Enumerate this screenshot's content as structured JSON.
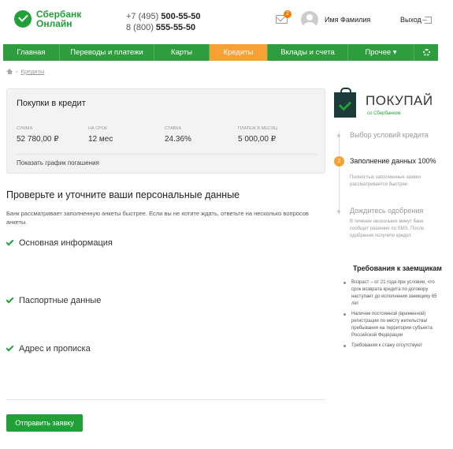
{
  "header": {
    "logo_line1": "Сбербанк",
    "logo_line2": "Онлайн",
    "phone1_prefix": "+7 (495) ",
    "phone1_number": "500-55-50",
    "phone2_prefix": "8 (800) ",
    "phone2_number": "555-55-50",
    "mail_count": "2",
    "user_name": "Имя Фамилия",
    "logout_label": "Выход"
  },
  "nav": {
    "items": [
      {
        "label": "Главная"
      },
      {
        "label": "Переводы и платежи"
      },
      {
        "label": "Карты"
      },
      {
        "label": "Кредиты"
      },
      {
        "label": "Вклады и счета"
      },
      {
        "label": "Прочее ▾"
      }
    ],
    "active_index": 3
  },
  "breadcrumb": {
    "current": "Кредиты"
  },
  "credit": {
    "title": "Покупки в кредит",
    "columns": [
      {
        "label": "Сумма",
        "value": "52 780,00 ₽"
      },
      {
        "label": "На срок",
        "value": "12 мес"
      },
      {
        "label": "Ставка",
        "value": "24.36%"
      },
      {
        "label": "Платеж в месяц",
        "value": "5 000,00 ₽"
      }
    ],
    "schedule_link": "Показать график погашения"
  },
  "form": {
    "title": "Проверьте и уточните ваши персональные данные",
    "description": "Банк рассматривает заполненную анкеты быстрее. Если вы не хотите ждать, ответьте на несколько вопросов анкеты.",
    "sections": [
      {
        "label": "Основная информация"
      },
      {
        "label": "Паспортные данные"
      },
      {
        "label": "Адрес и прописка"
      }
    ],
    "submit_label": "Отправить заявку"
  },
  "promo": {
    "title": "ПОКУПАЙ",
    "subtitle": "со Сбербанком"
  },
  "steps": [
    {
      "title": "Выбор условий кредита",
      "desc": ""
    },
    {
      "number": "2",
      "title": "Заполнение данных 100%",
      "desc": "Полностью заполненные заявки рассматривается быстрее"
    },
    {
      "title": "Дождитесь одобрения",
      "desc": "В течение нескольких минут банк сообщит решение по SMS. После одобрения получите кредит."
    }
  ],
  "requirements": {
    "title": "Требования к заемщикам",
    "items": [
      "Возраст – от 21 года при условии, что срок возврата кредита по договору наступает до исполнения заемщику 65 лет",
      "Наличие постоянной (временной) регистрации по месту жительства/пребывания на территории субъекта Российской Федерации",
      "Требования к стажу отсутствуют"
    ]
  },
  "colors": {
    "brand_green": "#21a038",
    "nav_green": "#2e9d3d",
    "accent_orange": "#f7a033"
  }
}
